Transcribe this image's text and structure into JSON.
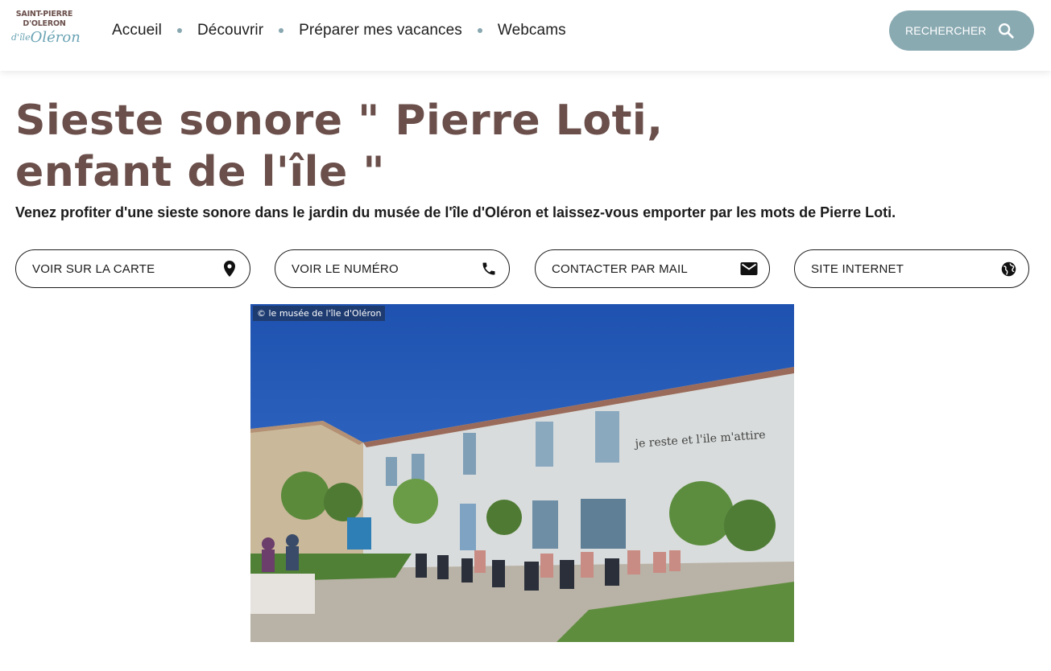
{
  "logo": {
    "line1": "SAINT-PIERRE",
    "line2": "D'OLERON",
    "script": "Oléron",
    "script_small": "d'île"
  },
  "nav": {
    "items": [
      "Accueil",
      "Découvrir",
      "Préparer mes vacances",
      "Webcams"
    ]
  },
  "search": {
    "label": "RECHERCHER",
    "icon": "search-icon"
  },
  "page": {
    "title": "Sieste sonore \" Pierre Loti, enfant de l'île \"",
    "title_line1": "Sieste sonore \" Pierre Loti,",
    "title_line2": "enfant de l'île \"",
    "subtitle": "Venez profiter d'une sieste sonore dans le jardin du musée de l'île d'Oléron et laissez-vous emporter par les mots de Pierre Loti."
  },
  "actions": [
    {
      "label": "VOIR SUR LA CARTE",
      "icon": "map-pin-icon"
    },
    {
      "label": "VOIR LE NUMÉRO",
      "icon": "phone-icon"
    },
    {
      "label": "CONTACTER PAR MAIL",
      "icon": "mail-icon"
    },
    {
      "label": "SITE INTERNET",
      "icon": "globe-icon"
    }
  ],
  "photo": {
    "credit": "© le musée de l'île d'Oléron",
    "facade_text": "je reste et l'ile m'attire"
  },
  "colors": {
    "brand": "#6a4f4b",
    "accent": "#8aaab2",
    "nav_dot": "#88a7b0"
  }
}
